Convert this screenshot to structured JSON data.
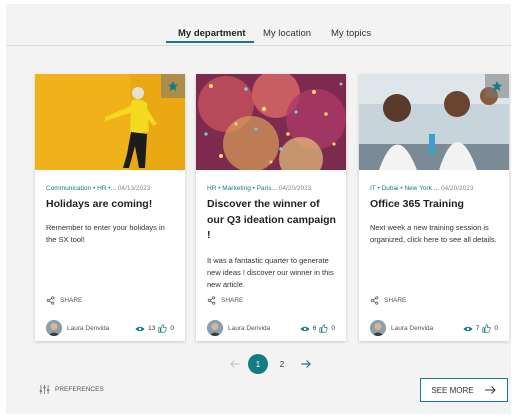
{
  "tabs": [
    {
      "label": "My department",
      "active": true
    },
    {
      "label": "My location",
      "active": false
    },
    {
      "label": "My topics",
      "active": false
    }
  ],
  "accent_color": "#127c82",
  "share_label": "SHARE",
  "cards": [
    {
      "image": "person-in-yellow-sweater-dancing",
      "meta": [
        "Communication",
        "HR",
        "..."
      ],
      "date": "04/13/2023",
      "title": "Holidays are coming!",
      "description": "Remember to enter your holidays in the SX tool!",
      "author": "Laura Denvida",
      "views": "13",
      "likes": "0"
    },
    {
      "image": "party-confetti",
      "meta": [
        "HR",
        "Marketing",
        "Paris..."
      ],
      "date": "04/20/2023",
      "title": "Discover the winner of our Q3 ideation campaign !",
      "description": "It was a fantastic quarter to generate new ideas ! discover our winner in this new article.",
      "author": "Laura Denvida",
      "views": "6",
      "likes": "0"
    },
    {
      "image": "children-in-classroom",
      "meta": [
        "IT",
        "Dubai",
        "New York ..."
      ],
      "date": "04/20/2023",
      "title": "Office 365 Training",
      "description": "Next week a new training session is organized, click here to see all details.",
      "author": "Laura Denvida",
      "views": "7",
      "likes": "0"
    }
  ],
  "pagination": {
    "current": "1",
    "next": "2"
  },
  "preferences_label": "PREFERENCES",
  "see_more_label": "SEE MORE"
}
